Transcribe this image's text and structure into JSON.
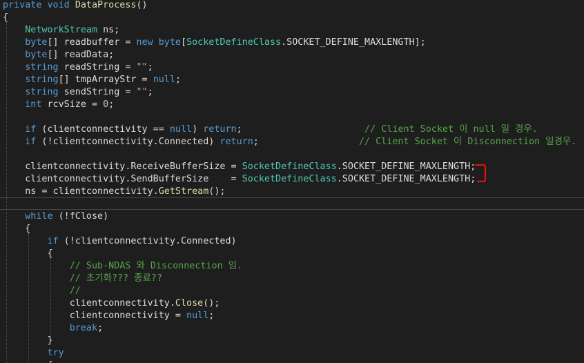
{
  "colors": {
    "background": "#1e1e1e",
    "plain": "#dcdcdc",
    "keyword": "#569cd6",
    "type": "#4ec9b0",
    "method": "#dcdcaa",
    "comment": "#57a64a",
    "number": "#b5cea8",
    "string": "#d69d85",
    "annotation": "#e51400"
  },
  "code": {
    "lines": [
      [
        {
          "t": "private",
          "c": "keyword"
        },
        {
          "t": " ",
          "c": "plain"
        },
        {
          "t": "void",
          "c": "keyword"
        },
        {
          "t": " ",
          "c": "plain"
        },
        {
          "t": "DataProcess",
          "c": "method"
        },
        {
          "t": "()",
          "c": "plain"
        }
      ],
      [
        {
          "t": "{",
          "c": "plain"
        }
      ],
      [
        {
          "t": "    ",
          "c": "plain"
        },
        {
          "t": "NetworkStream",
          "c": "type"
        },
        {
          "t": " ns;",
          "c": "plain"
        }
      ],
      [
        {
          "t": "    ",
          "c": "plain"
        },
        {
          "t": "byte",
          "c": "keyword"
        },
        {
          "t": "[] readbuffer = ",
          "c": "plain"
        },
        {
          "t": "new",
          "c": "keyword"
        },
        {
          "t": " ",
          "c": "plain"
        },
        {
          "t": "byte",
          "c": "keyword"
        },
        {
          "t": "[",
          "c": "plain"
        },
        {
          "t": "SocketDefineClass",
          "c": "type"
        },
        {
          "t": ".SOCKET_DEFINE_MAXLENGTH];",
          "c": "plain"
        }
      ],
      [
        {
          "t": "    ",
          "c": "plain"
        },
        {
          "t": "byte",
          "c": "keyword"
        },
        {
          "t": "[] readData;",
          "c": "plain"
        }
      ],
      [
        {
          "t": "    ",
          "c": "plain"
        },
        {
          "t": "string",
          "c": "keyword"
        },
        {
          "t": " readString = ",
          "c": "plain"
        },
        {
          "t": "\"\"",
          "c": "string"
        },
        {
          "t": ";",
          "c": "plain"
        }
      ],
      [
        {
          "t": "    ",
          "c": "plain"
        },
        {
          "t": "string",
          "c": "keyword"
        },
        {
          "t": "[] tmpArrayStr = ",
          "c": "plain"
        },
        {
          "t": "null",
          "c": "keyword"
        },
        {
          "t": ";",
          "c": "plain"
        }
      ],
      [
        {
          "t": "    ",
          "c": "plain"
        },
        {
          "t": "string",
          "c": "keyword"
        },
        {
          "t": " sendString = ",
          "c": "plain"
        },
        {
          "t": "\"\"",
          "c": "string"
        },
        {
          "t": ";",
          "c": "plain"
        }
      ],
      [
        {
          "t": "    ",
          "c": "plain"
        },
        {
          "t": "int",
          "c": "keyword"
        },
        {
          "t": " rcvSize = ",
          "c": "plain"
        },
        {
          "t": "0",
          "c": "number"
        },
        {
          "t": ";",
          "c": "plain"
        }
      ],
      [],
      [
        {
          "t": "    ",
          "c": "plain"
        },
        {
          "t": "if",
          "c": "keyword"
        },
        {
          "t": " (clientconnectivity == ",
          "c": "plain"
        },
        {
          "t": "null",
          "c": "keyword"
        },
        {
          "t": ") ",
          "c": "plain"
        },
        {
          "t": "return",
          "c": "keyword"
        },
        {
          "t": ";                      ",
          "c": "plain"
        },
        {
          "t": "// Client Socket 이 null 일 경우.",
          "c": "comment"
        }
      ],
      [
        {
          "t": "    ",
          "c": "plain"
        },
        {
          "t": "if",
          "c": "keyword"
        },
        {
          "t": " (!clientconnectivity.Connected) ",
          "c": "plain"
        },
        {
          "t": "return",
          "c": "keyword"
        },
        {
          "t": ";                  ",
          "c": "plain"
        },
        {
          "t": "// Client Socket 이 Disconnection 일경우.",
          "c": "comment"
        }
      ],
      [],
      [
        {
          "t": "    clientconnectivity.ReceiveBufferSize = ",
          "c": "plain"
        },
        {
          "t": "SocketDefineClass",
          "c": "type"
        },
        {
          "t": ".SOCKET_DEFINE_MAXLENGTH;",
          "c": "plain"
        }
      ],
      [
        {
          "t": "    clientconnectivity.SendBufferSize    = ",
          "c": "plain"
        },
        {
          "t": "SocketDefineClass",
          "c": "type"
        },
        {
          "t": ".SOCKET_DEFINE_MAXLENGTH;",
          "c": "plain"
        }
      ],
      [
        {
          "t": "    ns = clientconnectivity.",
          "c": "plain"
        },
        {
          "t": "GetStream",
          "c": "method"
        },
        {
          "t": "();",
          "c": "plain"
        }
      ],
      [],
      [
        {
          "t": "    ",
          "c": "plain"
        },
        {
          "t": "while",
          "c": "keyword"
        },
        {
          "t": " (!fClose)",
          "c": "plain"
        }
      ],
      [
        {
          "t": "    {",
          "c": "plain"
        }
      ],
      [
        {
          "t": "        ",
          "c": "plain"
        },
        {
          "t": "if",
          "c": "keyword"
        },
        {
          "t": " (!clientconnectivity.Connected)",
          "c": "plain"
        }
      ],
      [
        {
          "t": "        {",
          "c": "plain"
        }
      ],
      [
        {
          "t": "            ",
          "c": "plain"
        },
        {
          "t": "// Sub-NDAS 와 Disconnection 임.",
          "c": "comment"
        }
      ],
      [
        {
          "t": "            ",
          "c": "plain"
        },
        {
          "t": "// 초기화??? 종료??",
          "c": "comment"
        }
      ],
      [
        {
          "t": "            ",
          "c": "plain"
        },
        {
          "t": "//",
          "c": "comment"
        }
      ],
      [
        {
          "t": "            clientconnectivity.",
          "c": "plain"
        },
        {
          "t": "Close",
          "c": "method"
        },
        {
          "t": "();",
          "c": "plain"
        }
      ],
      [
        {
          "t": "            clientconnectivity = ",
          "c": "plain"
        },
        {
          "t": "null",
          "c": "keyword"
        },
        {
          "t": ";",
          "c": "plain"
        }
      ],
      [
        {
          "t": "            ",
          "c": "plain"
        },
        {
          "t": "break",
          "c": "keyword"
        },
        {
          "t": ";",
          "c": "plain"
        }
      ],
      [
        {
          "t": "        }",
          "c": "plain"
        }
      ],
      [
        {
          "t": "        ",
          "c": "plain"
        },
        {
          "t": "try",
          "c": "keyword"
        }
      ],
      [
        {
          "t": "        {",
          "c": "plain"
        }
      ]
    ]
  }
}
